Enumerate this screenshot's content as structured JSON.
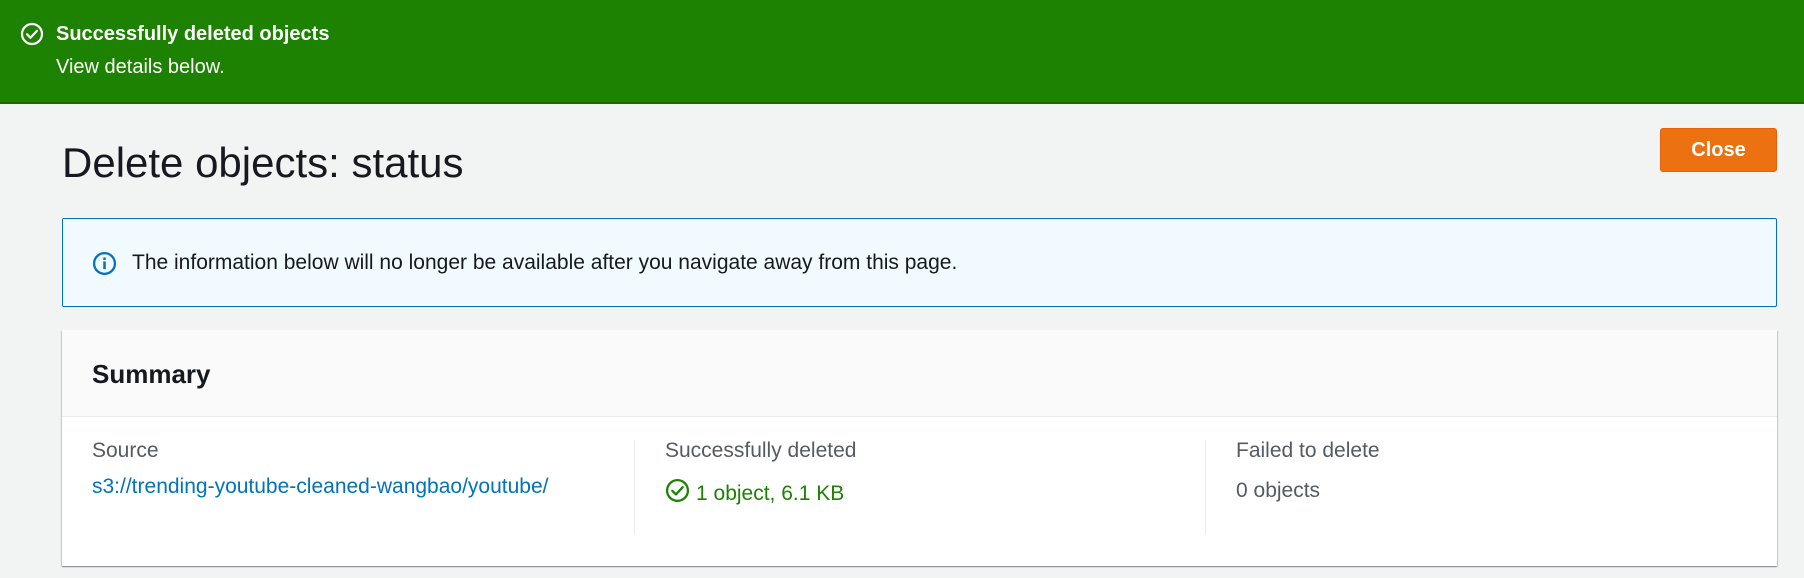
{
  "flash": {
    "title": "Successfully deleted objects",
    "message": "View details below.",
    "icon": "check-circle-icon",
    "color": "#1d8102"
  },
  "header": {
    "title": "Delete objects: status",
    "close_label": "Close",
    "close_color": "#ec7211"
  },
  "info_alert": {
    "icon": "info-icon",
    "text": "The information below will no longer be available after you navigate away from this page."
  },
  "summary": {
    "title": "Summary",
    "source": {
      "label": "Source",
      "value": "s3://trending-youtube-cleaned-wangbao/youtube/"
    },
    "successfully_deleted": {
      "label": "Successfully deleted",
      "value": "1 object, 6.1 KB",
      "icon": "check-circle-icon"
    },
    "failed_to_delete": {
      "label": "Failed to delete",
      "value": "0 objects"
    }
  }
}
